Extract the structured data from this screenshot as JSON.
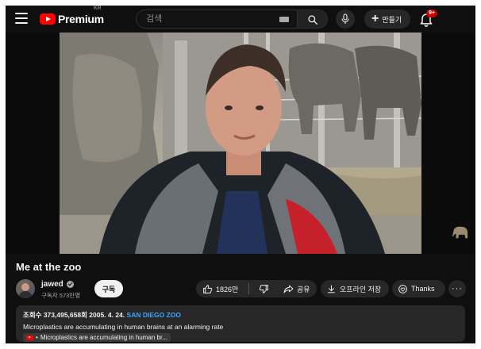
{
  "header": {
    "logo_text": "Premium",
    "logo_region": "KR",
    "search_placeholder": "검색",
    "create_label": "만들기",
    "notification_badge": "9+"
  },
  "video": {
    "title": "Me at the zoo"
  },
  "channel": {
    "name": "jawed",
    "subscribers": "구독자 573만명",
    "subscribe_label": "구독"
  },
  "actions": {
    "like_count": "1826만",
    "share_label": "공유",
    "offline_label": "오프라인 저장",
    "thanks_label": "Thanks",
    "more_label": "···"
  },
  "description": {
    "views_date": "조회수 373,495,658회  2005. 4. 24.",
    "tag": "SAN DIEGO ZOO",
    "line1": "Microplastics are accumulating in human brains at an alarming rate",
    "chip_prefix": "•",
    "chip_text": "Microplastics are accumulating in human br..."
  },
  "colors": {
    "background": "#0f0f0f",
    "pill": "#272727",
    "accent_red": "#ff0000",
    "link_blue": "#3ea6ff",
    "badge_red": "#cc0000"
  },
  "icons": [
    "menu-icon",
    "youtube-logo-icon",
    "keyboard-icon",
    "search-icon",
    "mic-icon",
    "plus-icon",
    "bell-icon",
    "elephant-icon",
    "verified-icon",
    "like-icon",
    "dislike-icon",
    "share-icon",
    "download-icon",
    "thanks-icon",
    "more-icon"
  ]
}
